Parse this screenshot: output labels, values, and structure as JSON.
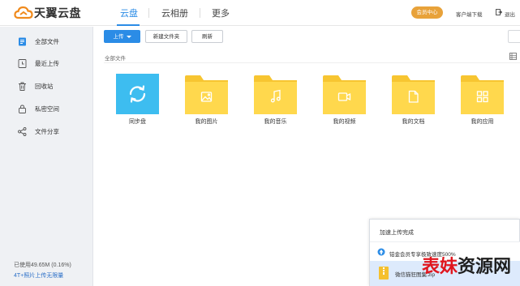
{
  "header": {
    "logo_text": "天翼云盘",
    "tabs": [
      {
        "label": "云盘",
        "active": true
      },
      {
        "label": "云相册",
        "active": false
      },
      {
        "label": "更多",
        "active": false
      }
    ],
    "member_button": "会员中心",
    "client_download": "客户端下载",
    "exit": "退出"
  },
  "sidebar": {
    "items": [
      {
        "label": "全部文件",
        "icon": "file-list-icon",
        "active": true
      },
      {
        "label": "最近上传",
        "icon": "clock-icon",
        "active": false
      },
      {
        "label": "回收站",
        "icon": "trash-icon",
        "active": false
      },
      {
        "label": "私密空间",
        "icon": "lock-icon",
        "active": false
      },
      {
        "label": "文件分享",
        "icon": "share-icon",
        "active": false
      }
    ],
    "storage_used": "已使用49.65M (0.16%)",
    "storage_link": "4T+照片上传无限量"
  },
  "toolbar": {
    "upload": "上传",
    "new_folder": "新建文件夹",
    "refresh": "刷新"
  },
  "breadcrumb": "全部文件",
  "folders": [
    {
      "name": "同步盘",
      "icon": "sync-icon",
      "type": "sync"
    },
    {
      "name": "我的图片",
      "icon": "image-icon",
      "type": "folder"
    },
    {
      "name": "我的音乐",
      "icon": "music-icon",
      "type": "folder"
    },
    {
      "name": "我的视频",
      "icon": "video-icon",
      "type": "folder"
    },
    {
      "name": "我的文档",
      "icon": "document-icon",
      "type": "folder"
    },
    {
      "name": "我的应用",
      "icon": "apps-icon",
      "type": "folder"
    }
  ],
  "upload_notice": {
    "title": "加速上传完成",
    "promo": "铂金会员专享极致速度500%",
    "file_name": "微信猫狂图集.zip"
  },
  "watermark": {
    "part1": "表妹",
    "part2": "资源网"
  },
  "colors": {
    "accent": "#2b8ce6",
    "folder_yellow": "#ffd84d",
    "folder_yellow_dark": "#f7c531",
    "sync_blue": "#3dbdf0",
    "member_orange": "#e8a23a",
    "sidebar_bg": "#eff1f4",
    "watermark_red": "#e0161e"
  }
}
